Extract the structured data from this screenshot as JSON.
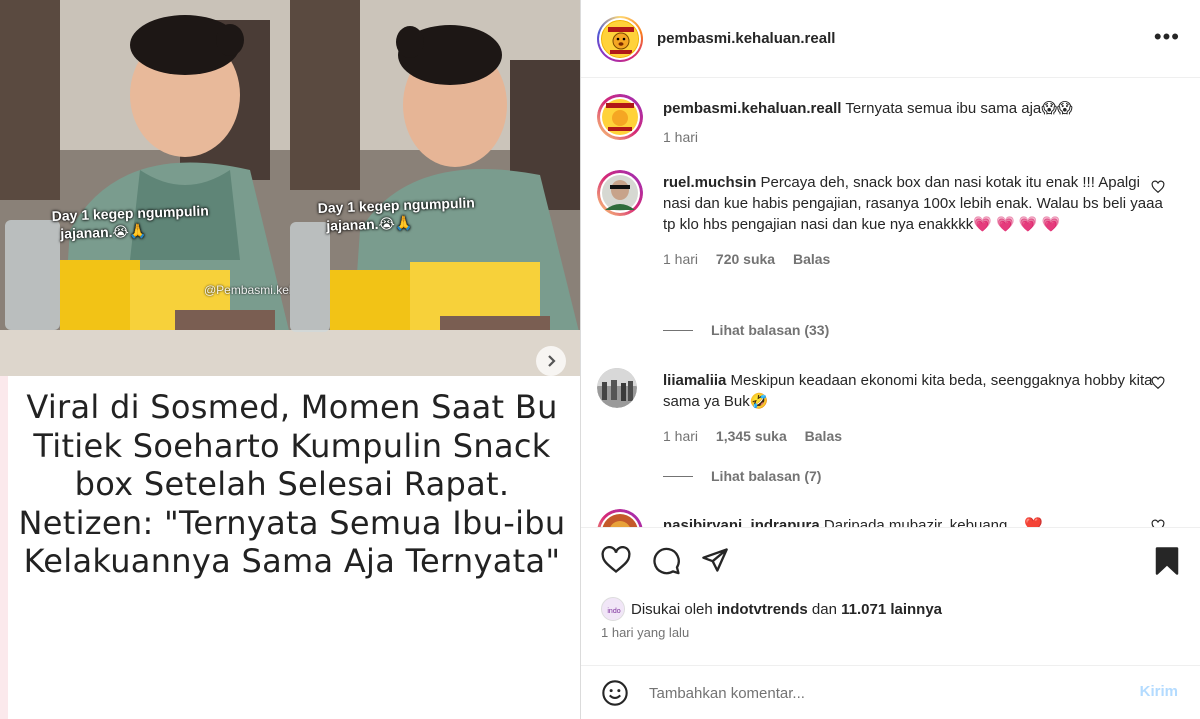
{
  "media": {
    "overlay_line1": "Day 1 kegep ngumpulin",
    "overlay_line2": "jajanan.😭🙏",
    "watermark": "@Pembasmi.kehaluan.reall",
    "headline": "Viral di Sosmed, Momen Saat Bu Titiek Soeharto Kumpulin Snack box Setelah Selesai Rapat. Netizen: \"Ternyata Semua Ibu-ibu Kelakuannya Sama Aja Ternyata\"",
    "next_icon": "chevron-right-icon"
  },
  "header": {
    "username": "pembasmi.kehaluan.reall",
    "more_label": "•••"
  },
  "caption": {
    "username": "pembasmi.kehaluan.reall",
    "text": "Ternyata semua ibu sama aja😱😱",
    "time": "1 hari"
  },
  "comments": [
    {
      "username": "ruel.muchsin",
      "text": "Percaya deh, snack box dan nasi kotak itu enak !!! Apalgi nasi dan kue habis pengajian, rasanya 100x lebih enak. Walau bs beli yaaa tp klo hbs pengajian nasi dan kue nya enakkkk💗 💗 💗 💗",
      "time": "1 hari",
      "likes": "720 suka",
      "reply": "Balas",
      "view_replies": "Lihat balasan (33)"
    },
    {
      "username": "liiamaliia",
      "text": "Meskipun keadaan ekonomi kita beda, seenggaknya hobby kita sama ya Buk🤣",
      "time": "1 hari",
      "likes": "1,345 suka",
      "reply": "Balas",
      "view_replies": "Lihat balasan (7)"
    },
    {
      "username": "nasibiryani_indrapura",
      "text": "Daripada mubazir, kebuang... ❤️"
    }
  ],
  "likes": {
    "prefix": "Disukai oleh",
    "user": "indotvtrends",
    "mid": "dan",
    "count": "11.071 lainnya"
  },
  "date": "1 hari yang lalu",
  "add_comment": {
    "placeholder": "Tambahkan komentar...",
    "post_label": "Kirim"
  },
  "colors": {
    "text": "#262626",
    "muted": "#737373",
    "post_disabled": "#b3dbff",
    "media_bg": "#fbe9ec"
  }
}
